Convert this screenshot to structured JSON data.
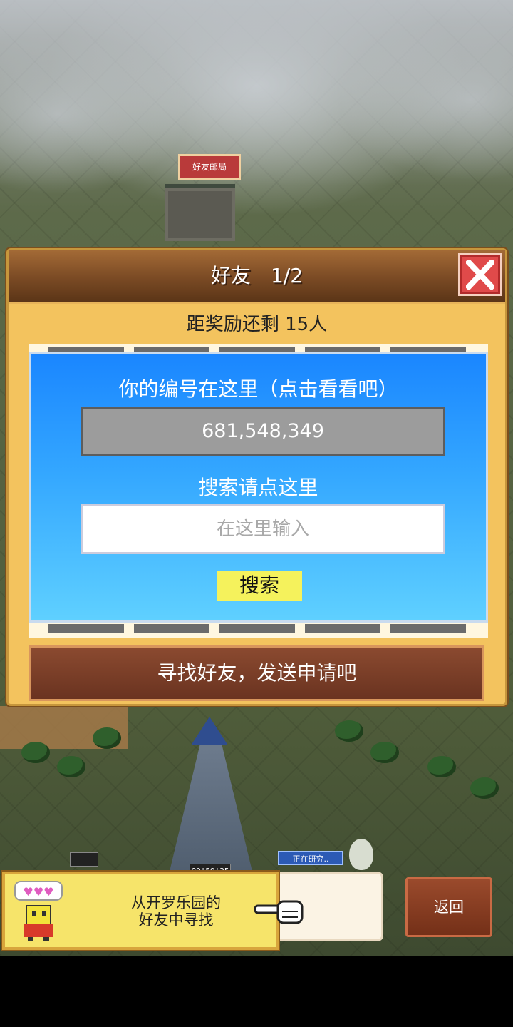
{
  "map": {
    "building_sign": "好友邮局",
    "research_tag": "正在研究..",
    "timer": "00'59'35"
  },
  "dialog": {
    "title": "好友　1/2",
    "reward_text": "距奖励还剩 15人",
    "your_id_label": "你的编号在这里（点击看看吧）",
    "your_id_value": "681,548,349",
    "search_label": "搜索请点这里",
    "search_placeholder": "在这里输入",
    "search_button": "搜索",
    "find_friends_button": "寻找好友，发送申请吧"
  },
  "hint": {
    "text_line1": "从开罗乐园的",
    "text_line2": "好友中寻找"
  },
  "back_button": "返回",
  "colors": {
    "dialog_bg": "#f3c35e",
    "panel_blue": "#1a86ff",
    "close_red": "#e04a4a",
    "search_yellow": "#f5f25c",
    "button_brown": "#7a3a24"
  },
  "icons": [
    "close-icon",
    "arrow-left-icon",
    "arrow-right-icon",
    "robot-mascot-icon",
    "pointing-hand-icon",
    "hearts-icon"
  ]
}
